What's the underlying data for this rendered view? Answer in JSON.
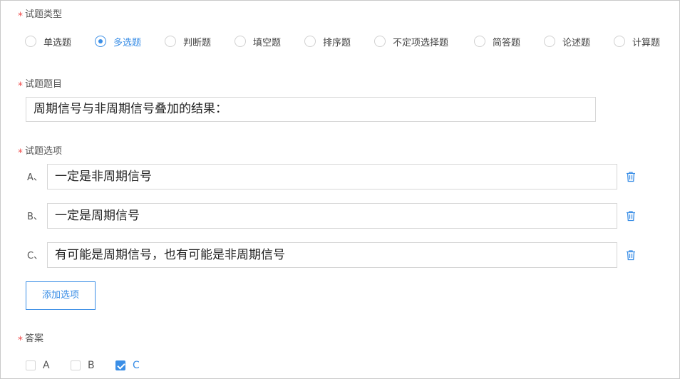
{
  "question_type": {
    "label": "试题类型",
    "required_mark": "*",
    "options": [
      {
        "label": "单选题",
        "checked": false
      },
      {
        "label": "多选题",
        "checked": true
      },
      {
        "label": "判断题",
        "checked": false
      },
      {
        "label": "填空题",
        "checked": false
      },
      {
        "label": "排序题",
        "checked": false
      },
      {
        "label": "不定项选择题",
        "checked": false
      },
      {
        "label": "简答题",
        "checked": false
      },
      {
        "label": "论述题",
        "checked": false
      },
      {
        "label": "计算题",
        "checked": false
      }
    ]
  },
  "question_title": {
    "label": "试题题目",
    "required_mark": "*",
    "value": "周期信号与非周期信号叠加的结果："
  },
  "question_options": {
    "label": "试题选项",
    "required_mark": "*",
    "items": [
      {
        "letter": "A、",
        "value": "一定是非周期信号",
        "delete_icon": "trash-icon"
      },
      {
        "letter": "B、",
        "value": "一定是周期信号",
        "delete_icon": "trash-icon"
      },
      {
        "letter": "C、",
        "value": "有可能是周期信号，也有可能是非周期信号",
        "delete_icon": "trash-icon"
      }
    ],
    "add_button_label": "添加选项"
  },
  "answer": {
    "label": "答案",
    "required_mark": "*",
    "choices": [
      {
        "label": "A",
        "checked": false
      },
      {
        "label": "B",
        "checked": false
      },
      {
        "label": "C",
        "checked": true
      }
    ]
  },
  "colors": {
    "accent": "#3a8ee6",
    "required": "#f05050",
    "border": "#d6d6d6"
  }
}
